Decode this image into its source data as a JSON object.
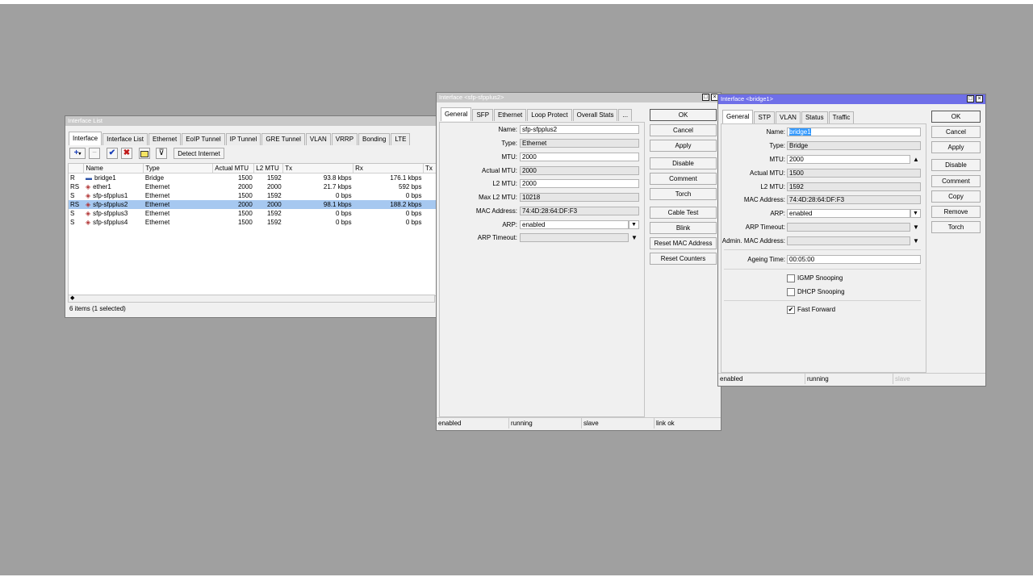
{
  "list_window": {
    "title": "Interface List",
    "tabs": [
      "Interface",
      "Interface List",
      "Ethernet",
      "EoIP Tunnel",
      "IP Tunnel",
      "GRE Tunnel",
      "VLAN",
      "VRRP",
      "Bonding",
      "LTE"
    ],
    "detect_internet": "Detect Internet",
    "columns": [
      "",
      "Name",
      "Type",
      "Actual MTU",
      "L2 MTU",
      "Tx",
      "Rx",
      "Tx"
    ],
    "rows": [
      {
        "flag": "R",
        "name": "bridge1",
        "type": "Bridge",
        "mtu": "1500",
        "l2mtu": "1592",
        "tx": "93.8 kbps",
        "rx": "176.1 kbps",
        "selected": false,
        "icon": "bridge-icon"
      },
      {
        "flag": "RS",
        "name": "ether1",
        "type": "Ethernet",
        "mtu": "2000",
        "l2mtu": "2000",
        "tx": "21.7 kbps",
        "rx": "592 bps",
        "selected": false,
        "icon": "ethernet-port-icon"
      },
      {
        "flag": "S",
        "name": "sfp-sfpplus1",
        "type": "Ethernet",
        "mtu": "1500",
        "l2mtu": "1592",
        "tx": "0 bps",
        "rx": "0 bps",
        "selected": false,
        "icon": "ethernet-port-icon"
      },
      {
        "flag": "RS",
        "name": "sfp-sfpplus2",
        "type": "Ethernet",
        "mtu": "2000",
        "l2mtu": "2000",
        "tx": "98.1 kbps",
        "rx": "188.2 kbps",
        "selected": true,
        "icon": "ethernet-port-icon"
      },
      {
        "flag": "S",
        "name": "sfp-sfpplus3",
        "type": "Ethernet",
        "mtu": "1500",
        "l2mtu": "1592",
        "tx": "0 bps",
        "rx": "0 bps",
        "selected": false,
        "icon": "ethernet-port-icon"
      },
      {
        "flag": "S",
        "name": "sfp-sfpplus4",
        "type": "Ethernet",
        "mtu": "1500",
        "l2mtu": "1592",
        "tx": "0 bps",
        "rx": "0 bps",
        "selected": false,
        "icon": "ethernet-port-icon"
      }
    ],
    "status": "6 items (1 selected)",
    "scroll_marker": "◆"
  },
  "sfp_window": {
    "title": "Interface <sfp-sfpplus2>",
    "tabs": [
      "General",
      "SFP",
      "Ethernet",
      "Loop Protect",
      "Overall Stats",
      "..."
    ],
    "fields": {
      "name": {
        "label": "Name:",
        "value": "sfp-sfpplus2"
      },
      "type": {
        "label": "Type:",
        "value": "Ethernet"
      },
      "mtu": {
        "label": "MTU:",
        "value": "2000"
      },
      "actual_mtu": {
        "label": "Actual MTU:",
        "value": "2000"
      },
      "l2mtu": {
        "label": "L2 MTU:",
        "value": "2000"
      },
      "max_l2mtu": {
        "label": "Max L2 MTU:",
        "value": "10218"
      },
      "mac": {
        "label": "MAC Address:",
        "value": "74:4D:28:64:DF:F3"
      },
      "arp": {
        "label": "ARP:",
        "value": "enabled"
      },
      "arp_timeout": {
        "label": "ARP Timeout:",
        "value": ""
      }
    },
    "buttons": [
      "OK",
      "Cancel",
      "Apply",
      "Disable",
      "Comment",
      "Torch",
      "Cable Test",
      "Blink",
      "Reset MAC Address",
      "Reset Counters"
    ],
    "status": [
      "enabled",
      "running",
      "slave",
      "link ok"
    ]
  },
  "bridge_window": {
    "title": "Interface <bridge1>",
    "tabs": [
      "General",
      "STP",
      "VLAN",
      "Status",
      "Traffic"
    ],
    "fields": {
      "name": {
        "label": "Name:",
        "value": "bridge1"
      },
      "type": {
        "label": "Type:",
        "value": "Bridge"
      },
      "mtu": {
        "label": "MTU:",
        "value": "2000"
      },
      "actual_mtu": {
        "label": "Actual MTU:",
        "value": "1500"
      },
      "l2mtu": {
        "label": "L2 MTU:",
        "value": "1592"
      },
      "mac": {
        "label": "MAC Address:",
        "value": "74:4D:28:64:DF:F3"
      },
      "arp": {
        "label": "ARP:",
        "value": "enabled"
      },
      "arp_timeout": {
        "label": "ARP Timeout:",
        "value": ""
      },
      "admin_mac": {
        "label": "Admin. MAC Address:",
        "value": ""
      },
      "ageing": {
        "label": "Ageing Time:",
        "value": "00:05:00"
      }
    },
    "checkboxes": [
      {
        "label": "IGMP Snooping",
        "checked": false
      },
      {
        "label": "DHCP Snooping",
        "checked": false
      },
      {
        "label": "Fast Forward",
        "checked": true
      }
    ],
    "buttons": [
      "OK",
      "Cancel",
      "Apply",
      "Disable",
      "Comment",
      "Copy",
      "Remove",
      "Torch"
    ],
    "status": [
      "enabled",
      "running",
      "slave"
    ]
  },
  "colors": {
    "desktop": "#a0a0a0",
    "active_title": "#6f6fe8",
    "inactive_title": "#c8c8c8",
    "selection": "#a6c8f0",
    "name_highlight": "#3399ff"
  }
}
